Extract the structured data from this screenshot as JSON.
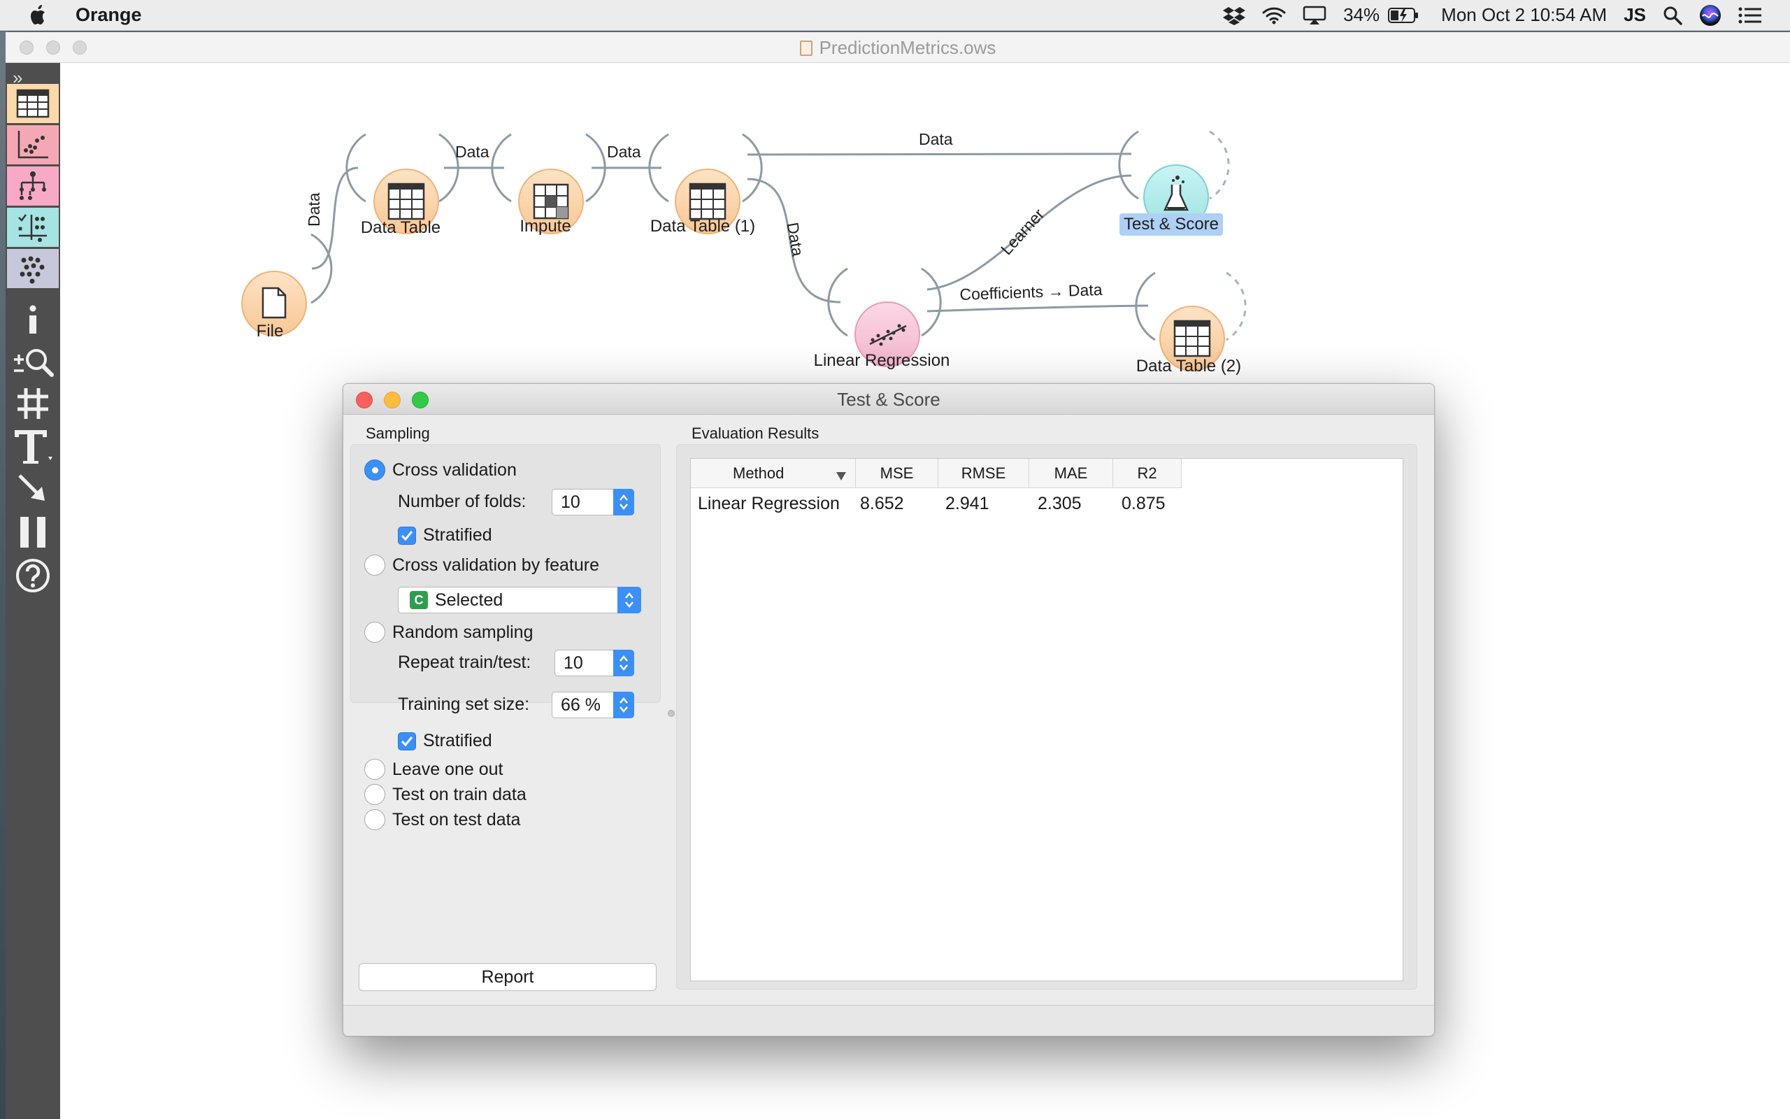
{
  "menubar": {
    "app_name": "Orange",
    "battery": "34%",
    "datetime": "Mon Oct 2  10:54 AM",
    "user": "JS"
  },
  "main_window": {
    "title": "PredictionMetrics.ows"
  },
  "toolbox": {
    "expand_glyph": "»",
    "categories": [
      "data-table-icon",
      "scatter-plot-icon",
      "tree-icon",
      "evaluate-icon",
      "cluster-icon"
    ],
    "tools": [
      "info-icon",
      "zoom-icon",
      "grid-icon",
      "text-icon",
      "arrow-icon",
      "pause-icon",
      "help-icon"
    ]
  },
  "canvas": {
    "nodes": {
      "file": "File",
      "data_table": "Data Table",
      "impute": "Impute",
      "data_table_1": "Data Table (1)",
      "test_score": "Test & Score",
      "linear_regression": "Linear Regression",
      "data_table_2": "Data Table (2)"
    },
    "links": {
      "file_to_table": "Data",
      "table_to_impute": "Data",
      "impute_to_table1": "Data",
      "table1_to_test": "Data",
      "table1_to_lr": "Data",
      "lr_to_test": "Learner",
      "lr_to_table2": "Coefficients → Data"
    },
    "colors": {
      "data_node": "#fbd3a8",
      "eval_node": "#b2ecec",
      "model_node": "#f8c6d8",
      "link": "#8e9aa2"
    }
  },
  "dialog": {
    "title": "Test & Score",
    "sampling": {
      "title": "Sampling",
      "cross_validation": "Cross validation",
      "folds_label": "Number of folds:",
      "folds_value": "10",
      "stratified_1": "Stratified",
      "cv_by_feature": "Cross validation by feature",
      "feature_badge": "C",
      "feature_value": "Selected",
      "random_sampling": "Random sampling",
      "repeat_label": "Repeat train/test:",
      "repeat_value": "10",
      "training_label": "Training set size:",
      "training_value": "66 %",
      "stratified_2": "Stratified",
      "leave_one_out": "Leave one out",
      "test_on_train": "Test on train data",
      "test_on_test": "Test on test data"
    },
    "report_button": "Report",
    "evaluation": {
      "title": "Evaluation Results",
      "columns": [
        "Method",
        "MSE",
        "RMSE",
        "MAE",
        "R2"
      ],
      "rows": [
        [
          "Linear Regression",
          "8.652",
          "2.941",
          "2.305",
          "0.875"
        ]
      ]
    }
  }
}
